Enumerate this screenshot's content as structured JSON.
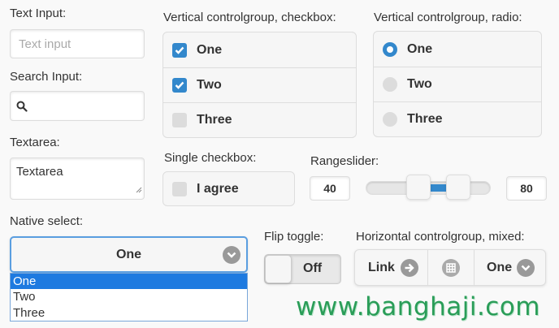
{
  "text_input": {
    "label": "Text Input:",
    "placeholder": "Text input"
  },
  "search_input": {
    "label": "Search Input:",
    "value": ""
  },
  "textarea": {
    "label": "Textarea:",
    "value": "Textarea"
  },
  "native_select": {
    "label": "Native select:",
    "selected": "One",
    "options": [
      "One",
      "Two",
      "Three"
    ],
    "highlighted_index": 0
  },
  "vertical_checkbox": {
    "label": "Vertical controlgroup, checkbox:",
    "items": [
      {
        "label": "One",
        "checked": true
      },
      {
        "label": "Two",
        "checked": true
      },
      {
        "label": "Three",
        "checked": false
      }
    ]
  },
  "vertical_radio": {
    "label": "Vertical controlgroup, radio:",
    "items": [
      {
        "label": "One",
        "selected": true
      },
      {
        "label": "Two",
        "selected": false
      },
      {
        "label": "Three",
        "selected": false
      }
    ]
  },
  "single_checkbox": {
    "label": "Single checkbox:",
    "item_label": "I agree",
    "checked": false
  },
  "rangeslider": {
    "label": "Rangeslider:",
    "min_value": "40",
    "max_value": "80",
    "scale_min": 0,
    "scale_max": 100
  },
  "flip_toggle": {
    "label": "Flip toggle:",
    "state": "Off"
  },
  "horizontal_group": {
    "label": "Horizontal controlgroup, mixed:",
    "link_label": "Link",
    "select_value": "One"
  },
  "watermark": "www.banghaji.com",
  "colors": {
    "accent": "#3388cc",
    "watermark": "#2a9d58"
  }
}
